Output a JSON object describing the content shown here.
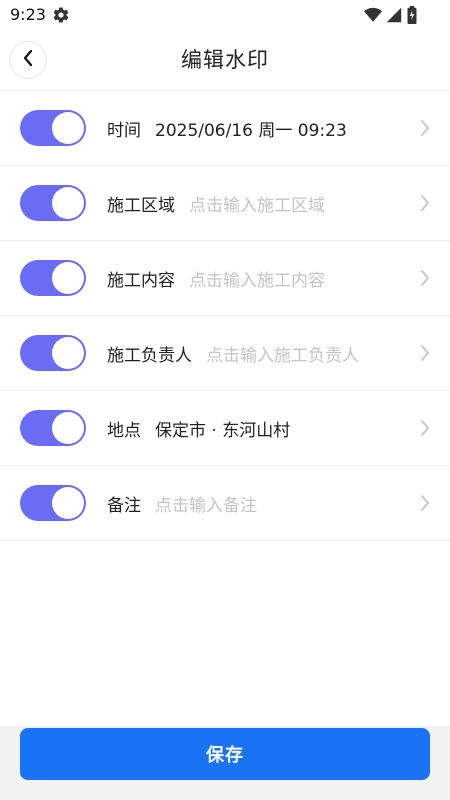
{
  "status_bar": {
    "time": "9:23",
    "icons": [
      "gear-icon",
      "wifi-icon",
      "signal-icon",
      "battery-icon"
    ]
  },
  "header": {
    "title": "编辑水印",
    "back_icon": "chevron-left-icon"
  },
  "rows": [
    {
      "label": "时间",
      "value": "2025/06/16 周一 09:23",
      "placeholder": "",
      "enabled": true
    },
    {
      "label": "施工区域",
      "value": "",
      "placeholder": "点击输入施工区域",
      "enabled": true
    },
    {
      "label": "施工内容",
      "value": "",
      "placeholder": "点击输入施工内容",
      "enabled": true
    },
    {
      "label": "施工负责人",
      "value": "",
      "placeholder": "点击输入施工负责人",
      "enabled": true
    },
    {
      "label": "地点",
      "value": "保定市 · 东河山村",
      "placeholder": "",
      "enabled": true
    },
    {
      "label": "备注",
      "value": "",
      "placeholder": "点击输入备注",
      "enabled": true
    }
  ],
  "footer": {
    "save_label": "保存"
  },
  "colors": {
    "toggle_on": "#6b6cf6",
    "primary": "#1a73f5",
    "placeholder": "#c4c4c4",
    "divider": "#ededed"
  }
}
